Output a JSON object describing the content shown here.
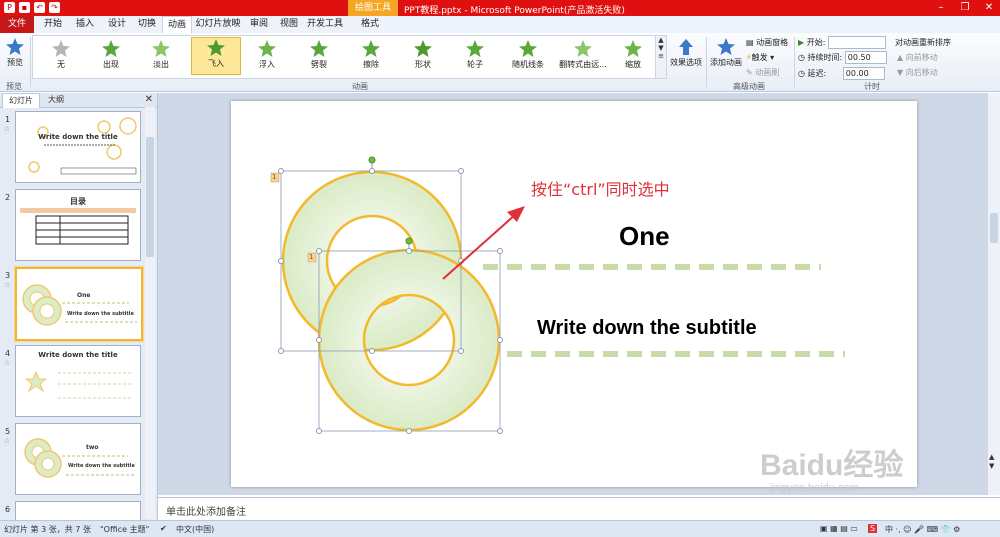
{
  "window": {
    "title": "PPT教程.pptx - Microsoft PowerPoint(产品激活失败)",
    "tool_tab": "绘图工具"
  },
  "tabs": [
    "文件",
    "开始",
    "插入",
    "设计",
    "切换",
    "动画",
    "幻灯片放映",
    "审阅",
    "视图",
    "开发工具",
    "格式"
  ],
  "ribbon": {
    "preview_label": "预览",
    "preview_group": "预览",
    "animation_group": "动画",
    "effects": [
      "无",
      "出现",
      "淡出",
      "飞入",
      "浮入",
      "劈裂",
      "擦除",
      "形状",
      "轮子",
      "随机线条",
      "翻转式由远...",
      "缩放"
    ],
    "effect_options": "效果选项",
    "add_animation": "添加动画",
    "advanced_group": "高级动画",
    "anim_pane": "动画窗格",
    "trigger": "触发",
    "anim_painter": "动画刷",
    "start_label": "开始:",
    "duration_label": "持续时间:",
    "duration_value": "00.50",
    "delay_label": "延迟:",
    "delay_value": "00.00",
    "reorder_title": "对动画重新排序",
    "move_earlier": "向前移动",
    "move_later": "向后移动",
    "timing_group": "计时"
  },
  "left_panel": {
    "tab_slides": "幻灯片",
    "tab_outline": "大纲",
    "thumbs": [
      {
        "num": "1",
        "title": "Write down the title"
      },
      {
        "num": "2",
        "title": "目录"
      },
      {
        "num": "3",
        "title": "One",
        "sub": "Write down the subtitle"
      },
      {
        "num": "4",
        "title": "Write down the title"
      },
      {
        "num": "5",
        "title": "two",
        "sub": "Write down the subtitle"
      },
      {
        "num": "6",
        "title": ""
      }
    ]
  },
  "slide": {
    "annotation": "按住“ctrl”同时选中",
    "title": "One",
    "subtitle": "Write down the subtitle",
    "anim_tag_1": "1",
    "anim_tag_2": "1"
  },
  "notes_placeholder": "单击此处添加备注",
  "status": {
    "slide_info": "幻灯片 第 3 张，共 7 张",
    "theme": "\"Office 主题\"",
    "language": "中文(中国)"
  },
  "watermark": {
    "brand": "Baidu经验",
    "url": "jingyan.baidu.com"
  },
  "colors": {
    "accent_red": "#e01010",
    "ring_stroke": "#f2b92b",
    "ring_fill": "#d8ebc1",
    "dash": "#c9dba8",
    "annotation": "#e0303a"
  }
}
